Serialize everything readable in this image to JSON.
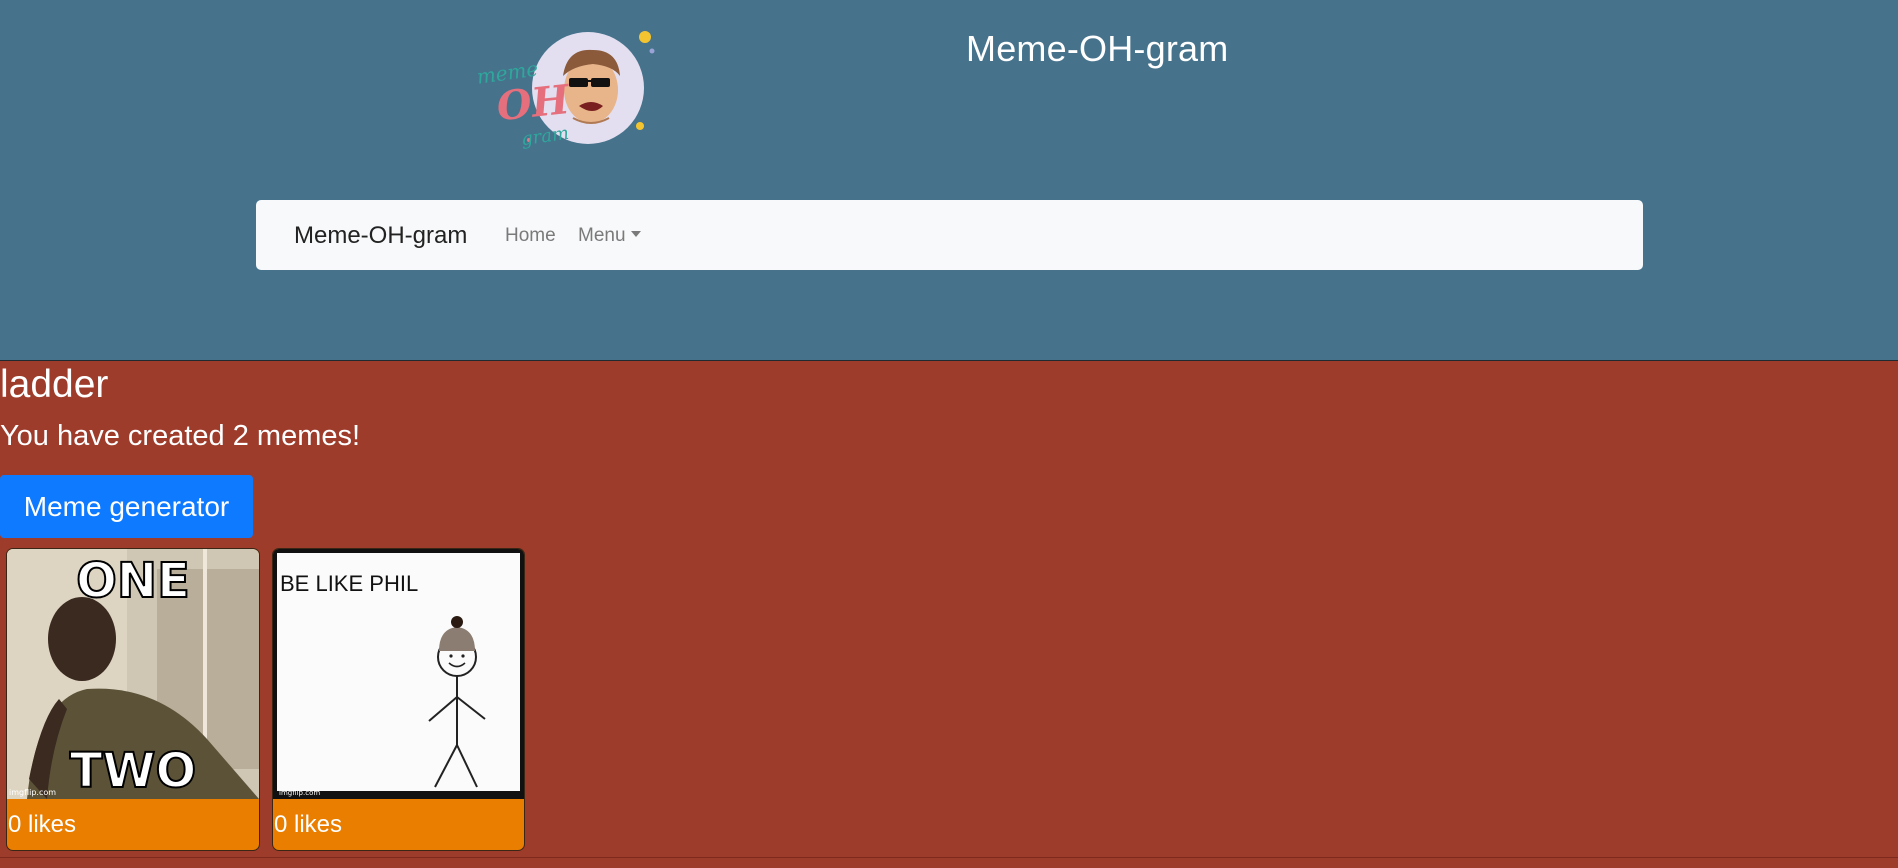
{
  "header": {
    "logo_alt": "meme-OH-gram",
    "logo_text": {
      "top": "meme",
      "mid": "OH",
      "bottom": "gram"
    },
    "title": "Meme-OH-gram"
  },
  "navbar": {
    "brand": "Meme-OH-gram",
    "links": [
      {
        "label": "Home"
      },
      {
        "label": "Menu"
      }
    ]
  },
  "main": {
    "username": "ladder",
    "meme_count_text": "You have created 2 memes!",
    "generator_button": "Meme generator",
    "memes": [
      {
        "top_text": "ONE",
        "bottom_text": "TWO",
        "watermark": "imgflip.com",
        "likes_label": "0 likes"
      },
      {
        "top_text": "BE LIKE PHIL",
        "watermark": "imgflip.com",
        "likes_label": "0 likes"
      }
    ]
  },
  "colors": {
    "header_bg": "#46728c",
    "page_bg": "#9e3c2c",
    "navbar_bg": "#f8f9fa",
    "button_bg": "#0e7aff",
    "card_bg": "#e97e00"
  }
}
